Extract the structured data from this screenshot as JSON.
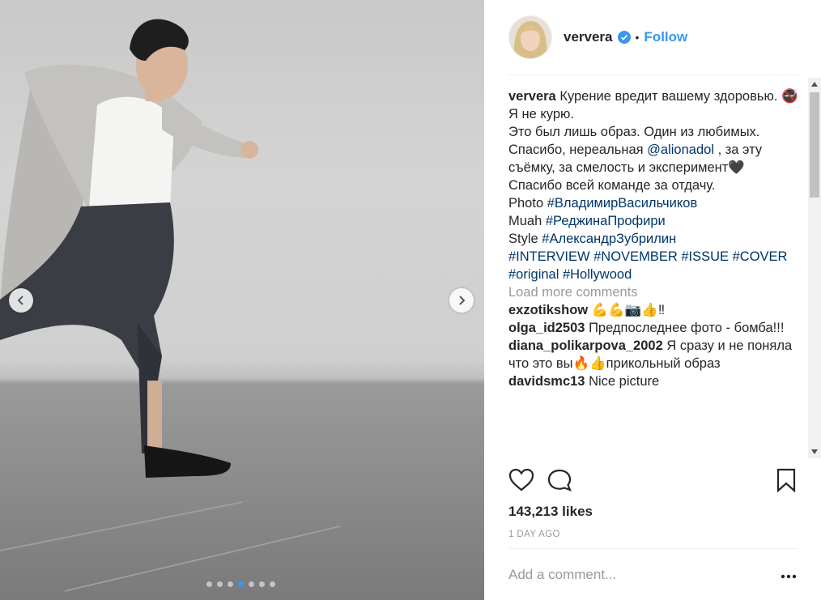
{
  "post": {
    "dots_count": 7,
    "active_dot": 3
  },
  "header": {
    "username": "ververa",
    "bullet": "•",
    "follow_label": "Follow"
  },
  "caption": {
    "username": "ververa",
    "line1": "Курение вредит вашему здоровью.",
    "emoji_smoking": "🚭",
    "line1b": "Я не курю.",
    "line2": "Это был лишь образ. Один из любимых.",
    "line3a": "Спасибо, нереальная",
    "mention": "@alionadol",
    "line3b": ", за эту съёмку, за смелость и эксперимент🖤",
    "line4": "Спасибо всей команде за отдачу.",
    "photo_label": "Photo",
    "photo_tag": "#ВладимирВасильчиков",
    "muah_label": "Muah",
    "muah_tag": "#РеджинаПрофири",
    "style_label": "Style",
    "style_tag": "#АлександрЗубрилин",
    "tags1": "#INTERVIEW #NOVEMBER #ISSUE #COVER",
    "tags2": "#original #Hollywood"
  },
  "load_more": "Load more comments",
  "comments": [
    {
      "user": "exzotikshow",
      "text": "💪💪📷👍‼"
    },
    {
      "user": "olga_id2503",
      "text": "Предпоследнее фото - бомба!!!"
    },
    {
      "user": "diana_polikarpova_2002",
      "text": "Я сразу и не поняла что это вы🔥👍прикольный образ"
    },
    {
      "user": "davidsmc13",
      "text": "Nice picture"
    }
  ],
  "likes": "143,213 likes",
  "time": "1 DAY AGO",
  "add_comment_placeholder": "Add a comment...",
  "colors": {
    "accent": "#3897f0",
    "link": "#003569",
    "muted": "#999999"
  }
}
